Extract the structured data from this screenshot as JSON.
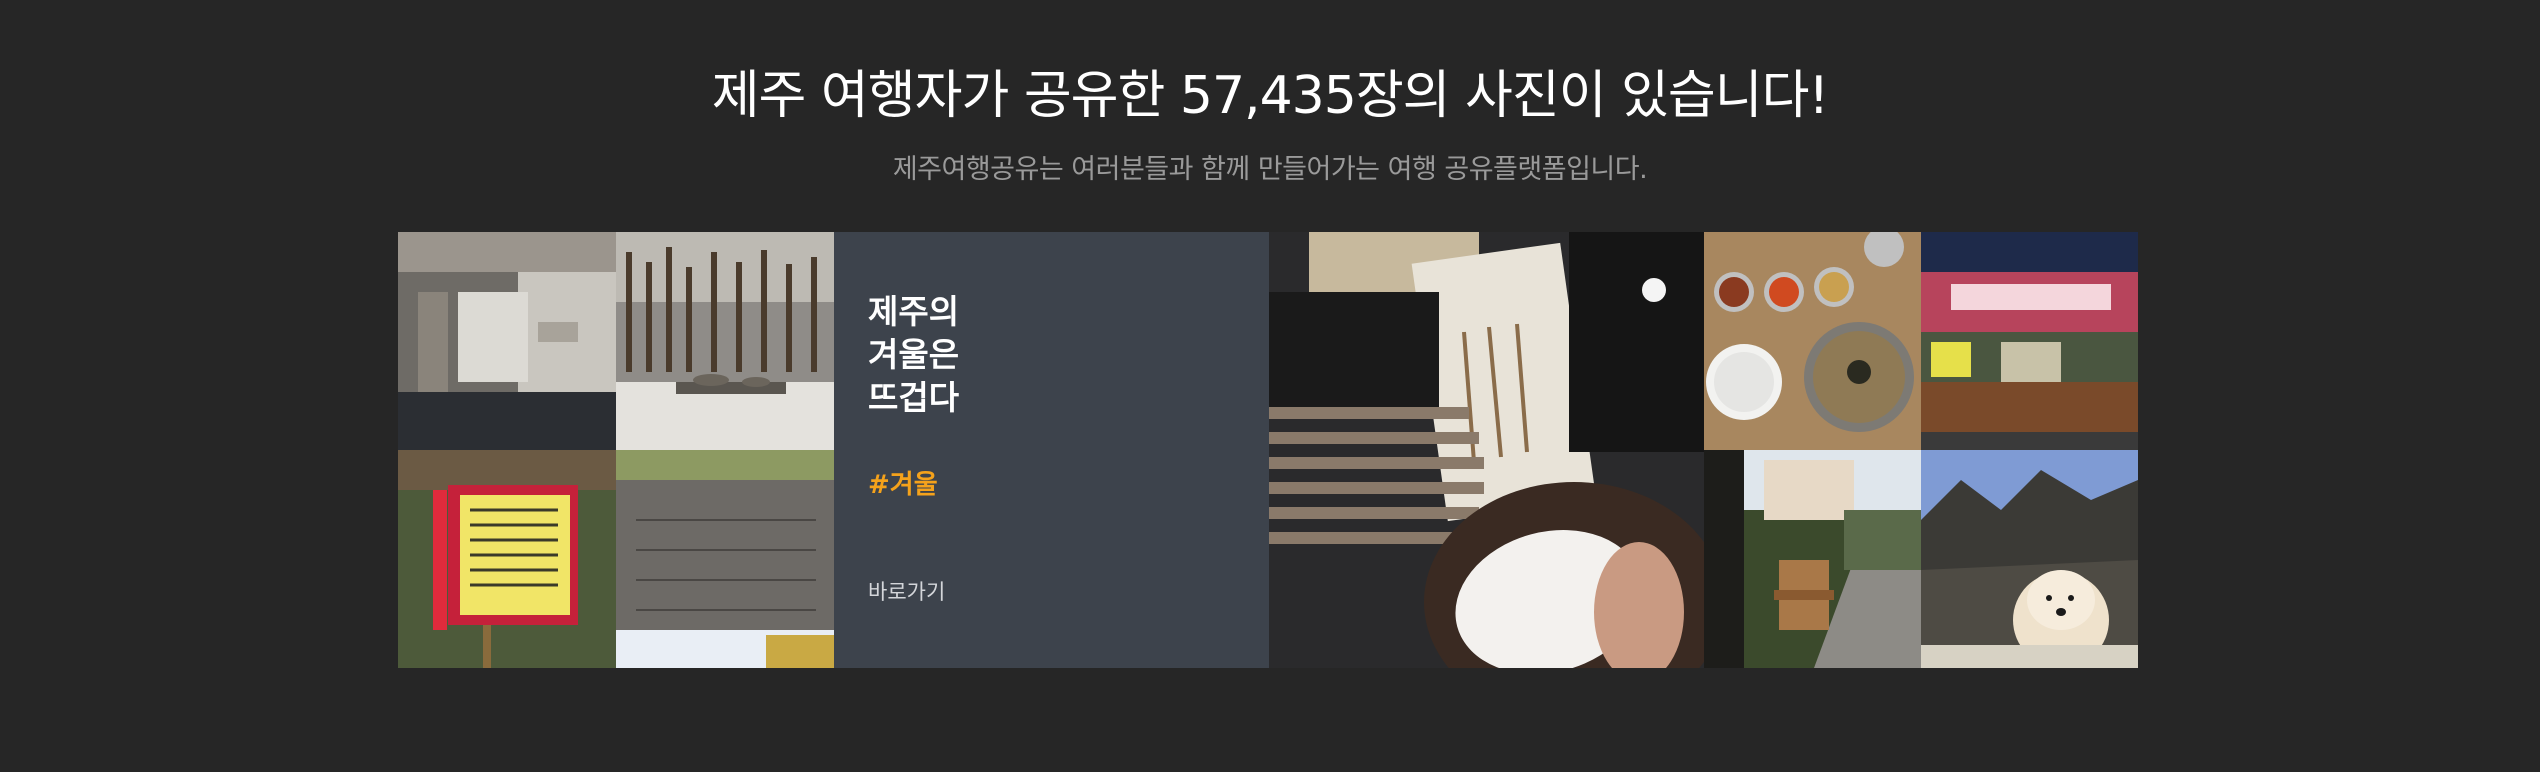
{
  "header": {
    "title": "제주 여행자가 공유한 57,435장의 사진이 있습니다!",
    "subtitle": "제주여행공유는 여러분들과 함께 만들어가는 여행 공유플랫폼입니다."
  },
  "feature": {
    "title": "제주의\n겨울은\n뜨겁다",
    "hashtag": "#겨울",
    "link_label": "바로가기"
  },
  "colors": {
    "background": "#262626",
    "feature_panel": "#3d434c",
    "hashtag": "#f5a21b"
  },
  "photos": [
    {
      "subject": "rotated-interior-room"
    },
    {
      "subject": "stone-altar-wooden-fence"
    },
    {
      "subject": "yellow-notice-sign"
    },
    {
      "subject": "stone-monument"
    },
    {
      "subject": "masked-traveler-selfie"
    },
    {
      "subject": "korean-meal-table"
    },
    {
      "subject": "restaurant-storefront-night"
    },
    {
      "subject": "garden-bench-pathway"
    },
    {
      "subject": "white-dog-lava-rocks"
    }
  ]
}
